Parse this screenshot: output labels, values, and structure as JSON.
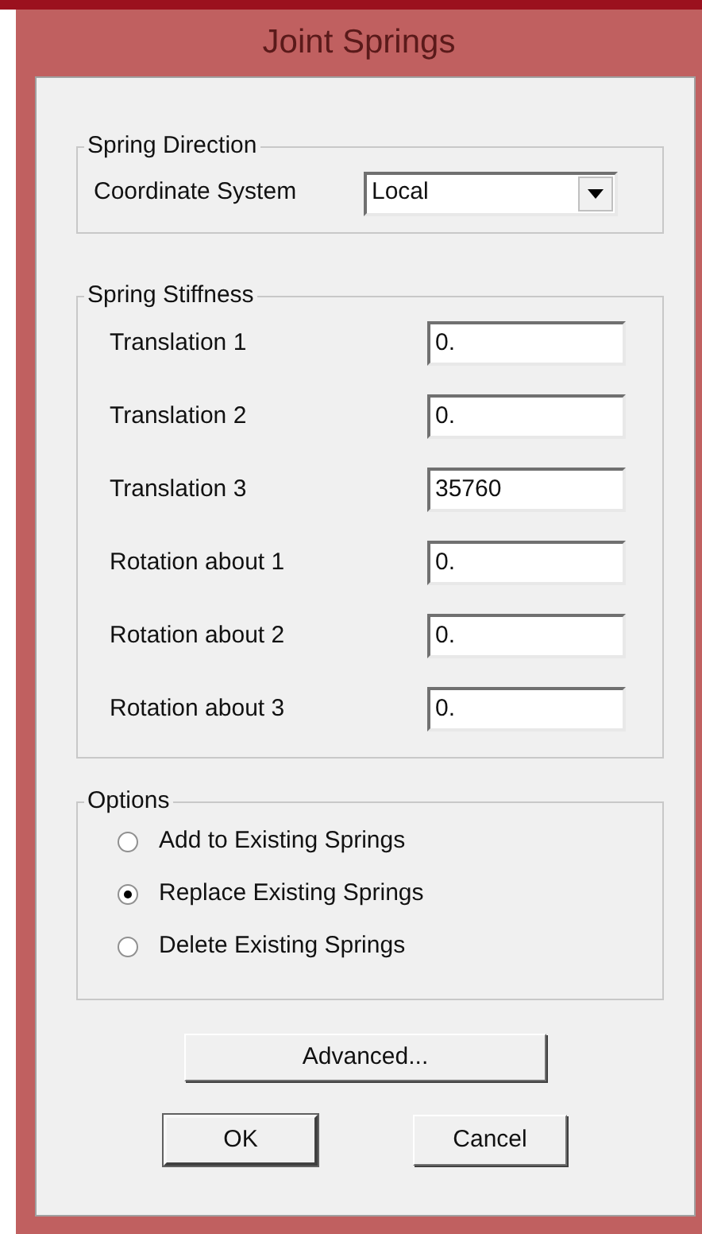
{
  "window": {
    "title": "Joint Springs"
  },
  "spring_direction": {
    "title": "Spring Direction",
    "label": "Coordinate System",
    "value": "Local"
  },
  "spring_stiffness": {
    "title": "Spring Stiffness",
    "fields": [
      {
        "label": "Translation 1",
        "value": "0."
      },
      {
        "label": "Translation 2",
        "value": "0."
      },
      {
        "label": "Translation 3",
        "value": "35760"
      },
      {
        "label": "Rotation about 1",
        "value": "0."
      },
      {
        "label": "Rotation about 2",
        "value": "0."
      },
      {
        "label": "Rotation about 3",
        "value": "0."
      }
    ]
  },
  "options": {
    "title": "Options",
    "items": [
      {
        "label": "Add to Existing Springs",
        "selected": false
      },
      {
        "label": "Replace Existing Springs",
        "selected": true
      },
      {
        "label": "Delete Existing Springs",
        "selected": false
      }
    ]
  },
  "buttons": {
    "advanced": "Advanced...",
    "ok": "OK",
    "cancel": "Cancel"
  }
}
